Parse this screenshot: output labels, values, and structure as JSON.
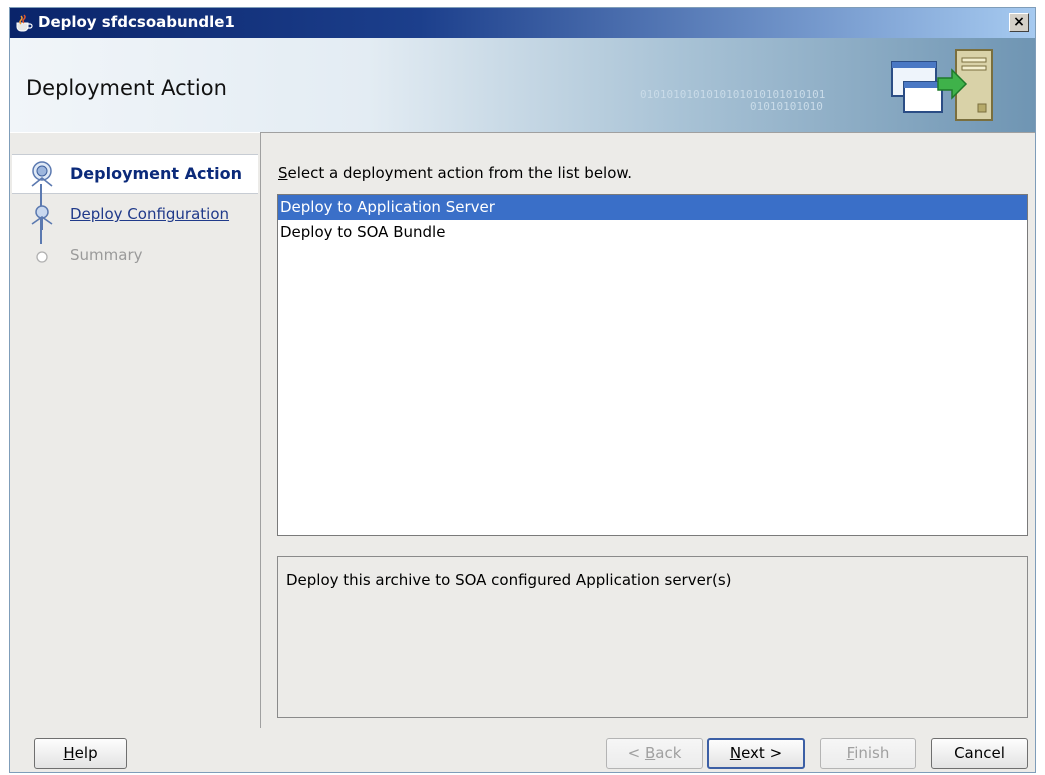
{
  "window": {
    "title": "Deploy sfdcsoabundle1",
    "close_glyph": "×"
  },
  "header": {
    "title": "Deployment Action",
    "binary_line1": "0101010101010101010101010101",
    "binary_line2": "01010101010"
  },
  "train": {
    "steps": [
      {
        "label": "Deployment Action",
        "state": "current"
      },
      {
        "label": "Deploy Configuration",
        "state": "enabled"
      },
      {
        "label": "Summary",
        "state": "disabled"
      }
    ]
  },
  "main": {
    "instruction_mnemonic": "S",
    "instruction_rest": "elect a deployment action from the list below.",
    "actions": [
      {
        "label": "Deploy to Application Server",
        "selected": true
      },
      {
        "label": "Deploy to SOA Bundle",
        "selected": false
      }
    ],
    "description": "Deploy this archive to SOA configured Application server(s)"
  },
  "buttons": {
    "help": {
      "mnemonic": "H",
      "rest": "elp"
    },
    "back": {
      "prefix": "< ",
      "mnemonic": "B",
      "rest": "ack"
    },
    "next": {
      "mnemonic": "N",
      "rest": "ext >"
    },
    "finish": {
      "mnemonic": "F",
      "rest": "inish"
    },
    "cancel": {
      "label": "Cancel"
    }
  },
  "colors": {
    "title_bar_start": "#0a246a",
    "selection": "#3a6fc8",
    "train_current": "#0b2a7a"
  }
}
